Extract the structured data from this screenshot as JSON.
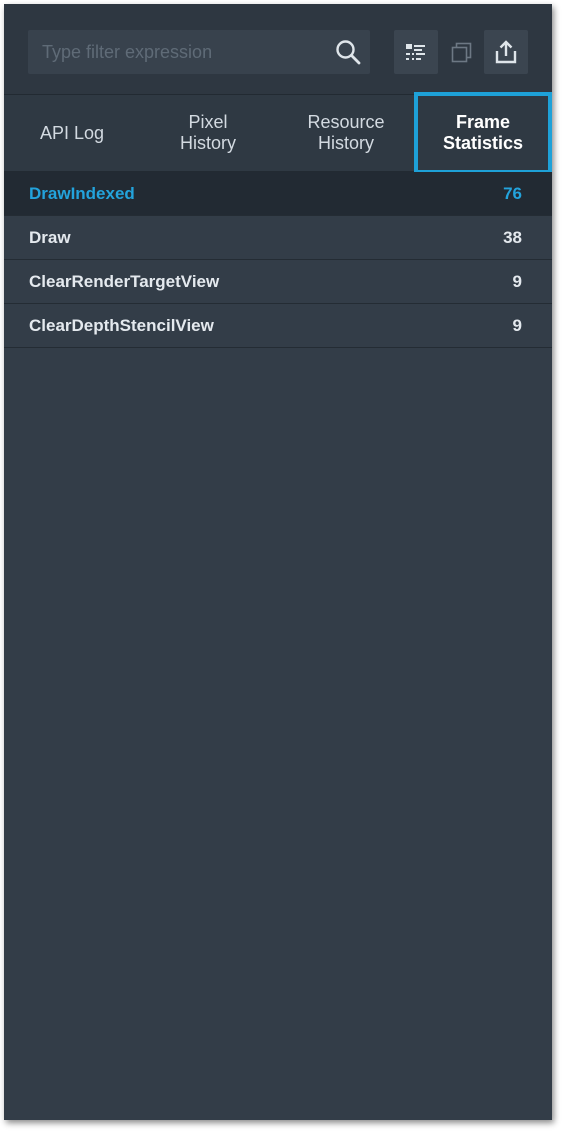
{
  "toolbar": {
    "search_placeholder": "Type filter expression",
    "search_value": "",
    "icons": {
      "search": "search-icon",
      "list_view": "list-view-icon",
      "copy": "copy-icon",
      "export": "export-icon"
    }
  },
  "tabs": [
    {
      "label": "API Log",
      "active": false
    },
    {
      "label": "Pixel\nHistory",
      "active": false
    },
    {
      "label": "Resource\nHistory",
      "active": false
    },
    {
      "label": "Frame\nStatistics",
      "active": true
    }
  ],
  "stats": [
    {
      "name": "DrawIndexed",
      "count": "76",
      "selected": true
    },
    {
      "name": "Draw",
      "count": "38",
      "selected": false
    },
    {
      "name": "ClearRenderTargetView",
      "count": "9",
      "selected": false
    },
    {
      "name": "ClearDepthStencilView",
      "count": "9",
      "selected": false
    }
  ],
  "colors": {
    "panel_bg": "#333d48",
    "accent": "#1ea1d8",
    "selected_text": "#23a3dc"
  }
}
